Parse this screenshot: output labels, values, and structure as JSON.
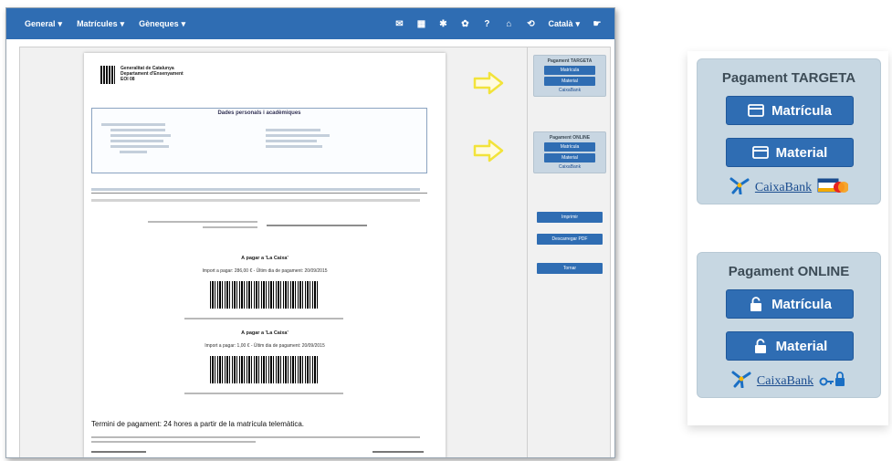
{
  "navbar": {
    "menus": [
      {
        "label": "General"
      },
      {
        "label": "Matrícules"
      },
      {
        "label": "Gèneques"
      }
    ],
    "user": "Català",
    "icons": [
      "envelope-icon",
      "grid-icon",
      "gear-icon",
      "cog-icon",
      "help-icon",
      "home-icon",
      "logout-icon"
    ]
  },
  "document": {
    "org_line1": "Generalitat de Catalunya",
    "org_line2": "Departament d'Ensenyament",
    "org_line3": "EOI 08",
    "dades_title": "Dades personals i acadèmiques",
    "pay1_title": "A pagar a 'La Caixa'",
    "pay1_import": "Import a pagar: 286,00 € - Últim dia de pagament: 20/09/2015",
    "pay2_title": "A pagar a 'La Caixa'",
    "pay2_import": "Import a pagar: 1,00 € - Últim dia de pagament: 20/09/2015",
    "terminis": "Termini de pagament: 24 hores a partir de la matrícula telemàtica."
  },
  "sidebar": {
    "targeta_title": "Pagament TARGETA",
    "online_title": "Pagament ONLINE",
    "matricula_label": "Matrícula",
    "material_label": "Material",
    "caixabank": "CaixaBank",
    "imprimir_label": "Imprimir",
    "descarregar_label": "Descarregar PDF",
    "tornar_label": "Tornar"
  },
  "zoom": {
    "targeta_title": "Pagament TARGETA",
    "online_title": "Pagament ONLINE",
    "matricula_label": "Matrícula",
    "material_label": "Material",
    "caixabank": "CaixaBank"
  },
  "colors": {
    "brand_blue": "#2f6db3",
    "box_bg": "#c7d7e2",
    "arrow_yellow": "#f2e33a"
  }
}
